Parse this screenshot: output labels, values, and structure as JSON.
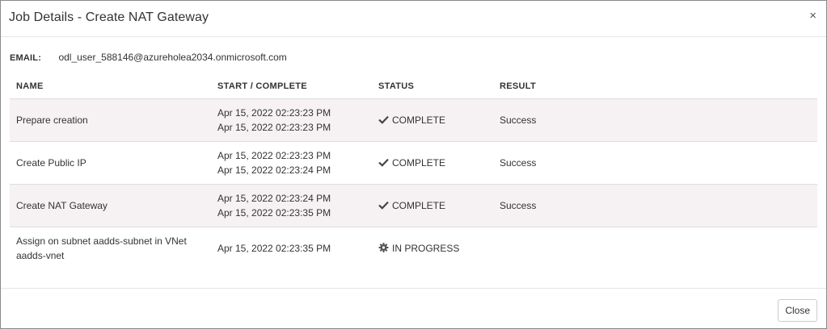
{
  "dialog": {
    "title": "Job Details - Create NAT Gateway",
    "close_icon": "×"
  },
  "email": {
    "label": "EMAIL:",
    "value": "odl_user_588146@azureholea2034.onmicrosoft.com"
  },
  "table": {
    "headers": {
      "name": "NAME",
      "time": "START / COMPLETE",
      "status": "STATUS",
      "result": "RESULT"
    },
    "rows": [
      {
        "name_line1": "Prepare creation",
        "name_line2": "",
        "start": "Apr 15, 2022 02:23:23 PM",
        "complete": "Apr 15, 2022 02:23:23 PM",
        "status_icon": "check-icon",
        "status": "COMPLETE",
        "result": "Success"
      },
      {
        "name_line1": "Create Public IP",
        "name_line2": "",
        "start": "Apr 15, 2022 02:23:23 PM",
        "complete": "Apr 15, 2022 02:23:24 PM",
        "status_icon": "check-icon",
        "status": "COMPLETE",
        "result": "Success"
      },
      {
        "name_line1": "Create NAT Gateway",
        "name_line2": "",
        "start": "Apr 15, 2022 02:23:24 PM",
        "complete": "Apr 15, 2022 02:23:35 PM",
        "status_icon": "check-icon",
        "status": "COMPLETE",
        "result": "Success"
      },
      {
        "name_line1": "Assign on subnet aadds-subnet in VNet",
        "name_line2": "aadds-vnet",
        "start": "Apr 15, 2022 02:23:35 PM",
        "complete": "",
        "status_icon": "gear-icon",
        "status": "IN PROGRESS",
        "result": ""
      }
    ]
  },
  "footer": {
    "close_label": "Close"
  }
}
